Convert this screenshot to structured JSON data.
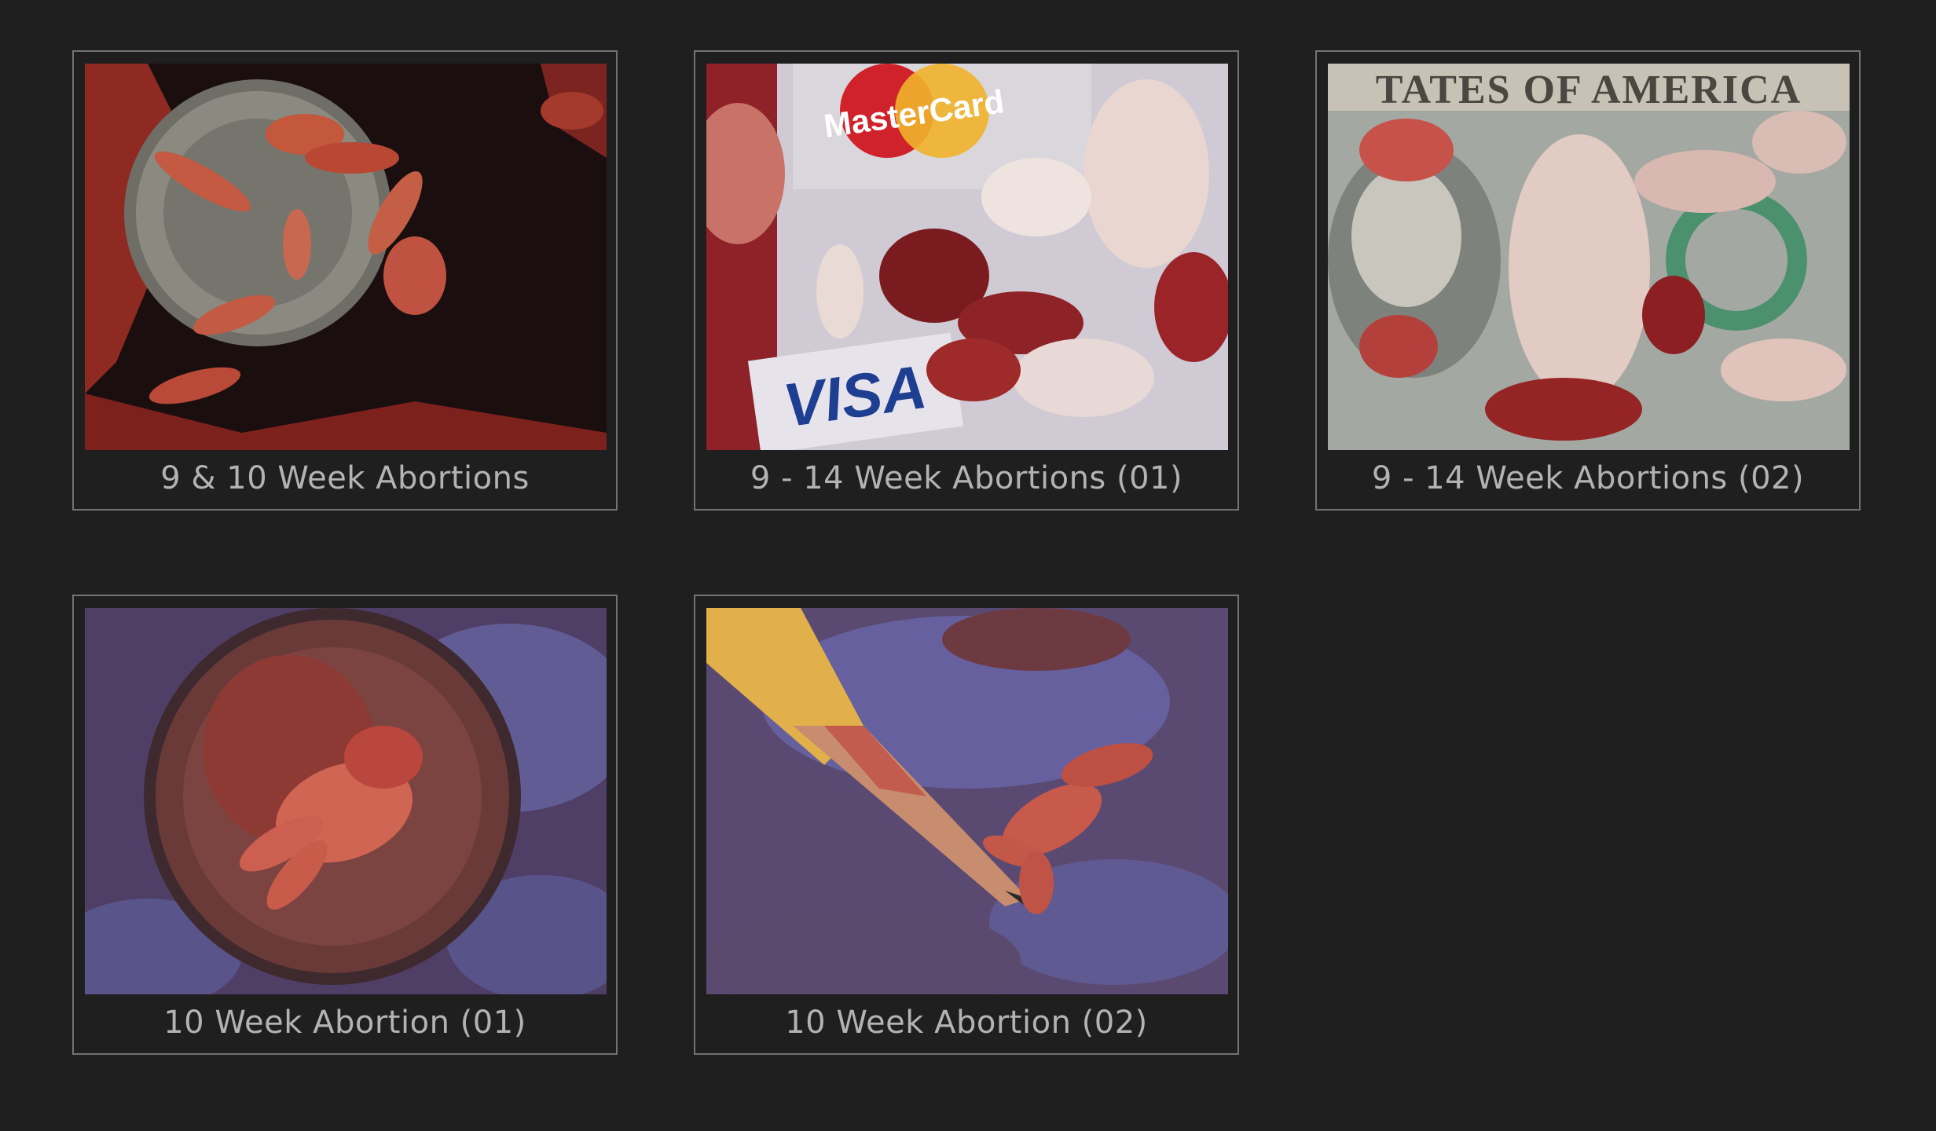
{
  "gallery": {
    "items": [
      {
        "caption": "9 & 10 Week Abortions",
        "thumbnail": "coin-and-remains-photo",
        "colors": {
          "base": "#1c0f10",
          "accent": "#b63a2e"
        }
      },
      {
        "caption": "9 - 14 Week Abortions (01)",
        "thumbnail": "credit-cards-and-remains-photo",
        "card_texts": [
          "MasterCard",
          "VISA"
        ],
        "colors": {
          "base": "#cfc9d2",
          "accent": "#a3232a"
        }
      },
      {
        "caption": "9 - 14 Week Abortions (02)",
        "thumbnail": "dollar-bill-and-remains-photo",
        "bill_text": "TATES OF AMERICA",
        "colors": {
          "base": "#9aa09a",
          "accent": "#a2292c"
        }
      },
      {
        "caption": "10 Week Abortion (01)",
        "thumbnail": "quarter-coin-and-hand-photo",
        "colors": {
          "base": "#5a4d78",
          "accent": "#a4302c"
        }
      },
      {
        "caption": "10 Week Abortion (02)",
        "thumbnail": "pencil-and-hand-photo",
        "colors": {
          "base": "#6a5a86",
          "accent": "#a8352e"
        }
      }
    ]
  },
  "theme": {
    "background": "#1f1f1f",
    "border": "#737373",
    "caption_color": "#b3b3b3"
  }
}
